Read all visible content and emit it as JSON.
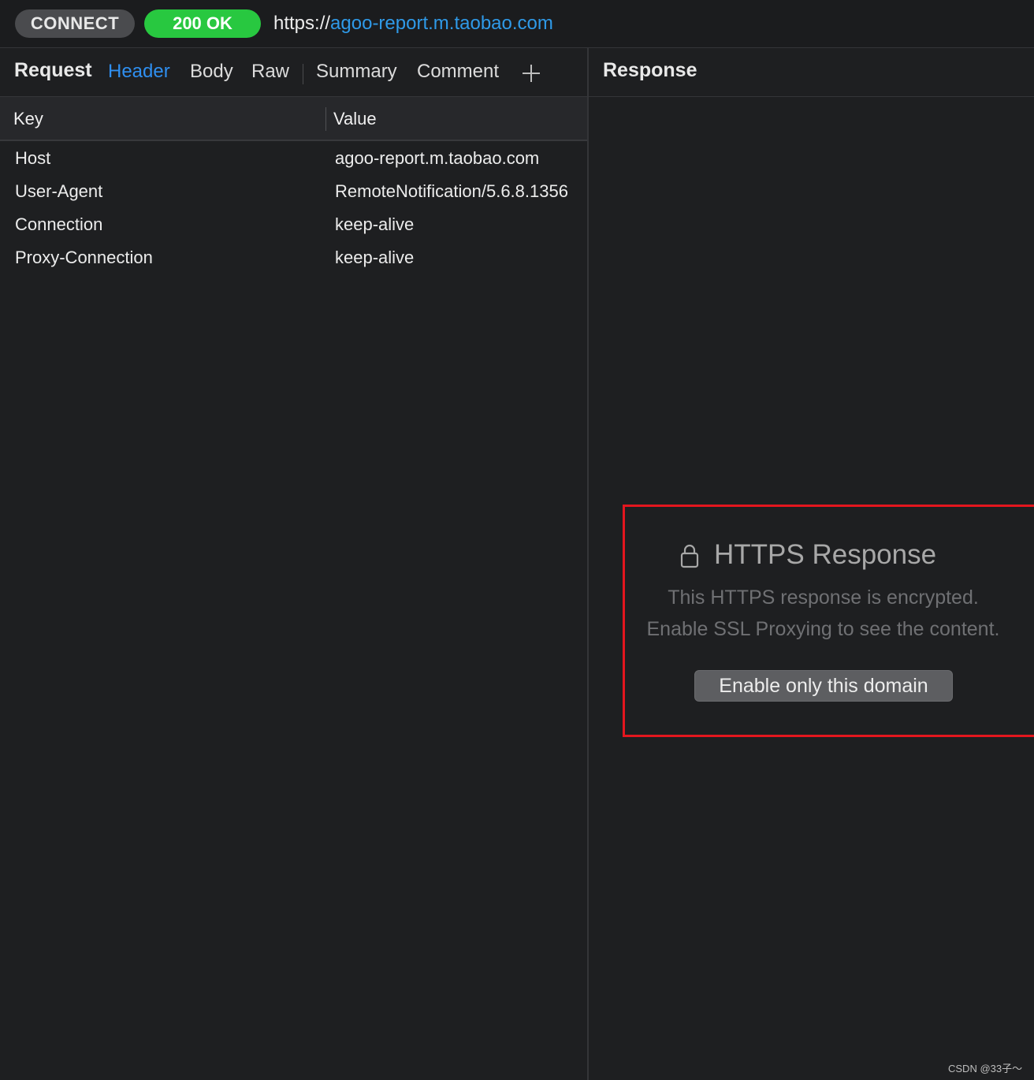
{
  "topbar": {
    "method": "CONNECT",
    "status": "200 OK",
    "url_scheme": "https://",
    "url_host": "agoo-report.m.taobao.com"
  },
  "request": {
    "title": "Request",
    "tabs": [
      "Header",
      "Body",
      "Raw",
      "Summary",
      "Comment"
    ],
    "active_tab": "Header",
    "columns": {
      "key": "Key",
      "value": "Value"
    },
    "headers": [
      {
        "key": "Host",
        "value": "agoo-report.m.taobao.com"
      },
      {
        "key": "User-Agent",
        "value": "RemoteNotification/5.6.8.1356"
      },
      {
        "key": "Connection",
        "value": "keep-alive"
      },
      {
        "key": "Proxy-Connection",
        "value": "keep-alive"
      }
    ]
  },
  "response": {
    "title": "Response",
    "https_title": "HTTPS Response",
    "line1": "This HTTPS response is encrypted.",
    "line2": "Enable SSL Proxying to see the content.",
    "button": "Enable only this domain",
    "highlight_color": "#e4161e"
  },
  "watermark": "CSDN @33子～",
  "colors": {
    "accent": "#2f8ff0",
    "status_ok": "#28c840",
    "background": "#1e1f21"
  }
}
